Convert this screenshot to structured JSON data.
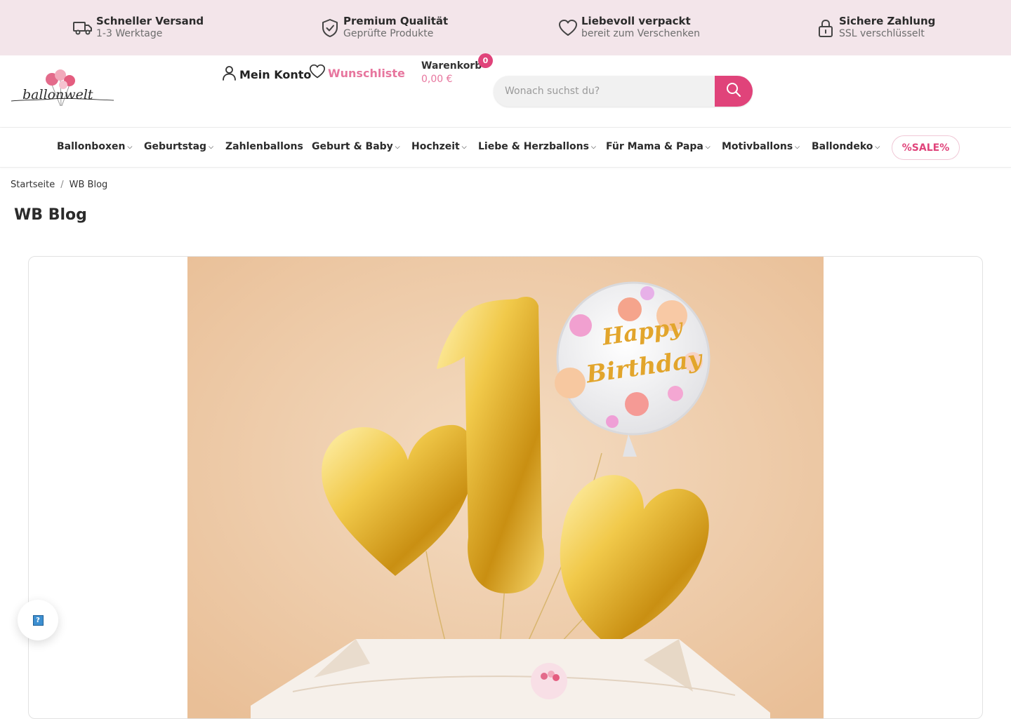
{
  "benefits": [
    {
      "icon": "truck-icon",
      "title": "Schneller Versand",
      "subtitle": "1-3 Werktage"
    },
    {
      "icon": "shield-check-icon",
      "title": "Premium Qualität",
      "subtitle": "Geprüfte Produkte"
    },
    {
      "icon": "heart-icon",
      "title": "Liebevoll verpackt",
      "subtitle": "bereit zum Verschenken"
    },
    {
      "icon": "lock-icon",
      "title": "Sichere Zahlung",
      "subtitle": "SSL verschlüsselt"
    }
  ],
  "header": {
    "logo_text": "ballonwelt",
    "account_label": "Mein Konto",
    "wishlist_label": "Wunschliste",
    "cart_label": "Warenkorb",
    "cart_amount": "0,00 €",
    "cart_count": "0",
    "search_placeholder": "Wonach suchst du?"
  },
  "nav": {
    "items": [
      {
        "label": "Ballonboxen",
        "has_dropdown": true
      },
      {
        "label": "Geburtstag",
        "has_dropdown": true
      },
      {
        "label": "Zahlenballons",
        "has_dropdown": false
      },
      {
        "label": "Geburt & Baby",
        "has_dropdown": true
      },
      {
        "label": "Hochzeit",
        "has_dropdown": true
      },
      {
        "label": "Liebe & Herzballons",
        "has_dropdown": true
      },
      {
        "label": "Für Mama & Papa",
        "has_dropdown": true
      },
      {
        "label": "Motivballons",
        "has_dropdown": true
      },
      {
        "label": "Ballondeko",
        "has_dropdown": true
      }
    ],
    "sale_label": "%SALE%"
  },
  "breadcrumb": [
    "Startseite",
    "WB Blog"
  ],
  "page_title": "WB Blog",
  "hero": {
    "number_balloon": "1",
    "foil_text_line1": "Happy",
    "foil_text_line2": "Birthday"
  },
  "colors": {
    "accent": "#e0437a",
    "accent_light": "#e7769e",
    "topbar_bg": "#f3e5ea",
    "hero_bg": "#efc8a2",
    "gold": "#e5b23a"
  },
  "help_icon": "question-icon"
}
